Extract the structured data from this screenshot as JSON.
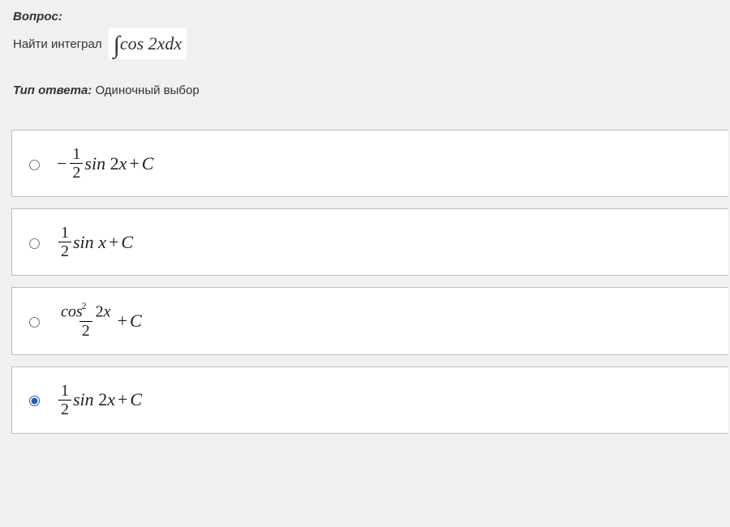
{
  "question": {
    "label": "Вопрос:",
    "prompt_text": "Найти интеграл",
    "integral": {
      "sym": "∫",
      "body": "cos 2xdx"
    }
  },
  "answer_type": {
    "label": "Тип ответа:",
    "value": "Одиночный выбор"
  },
  "options": [
    {
      "id": "opt1",
      "selected": false,
      "lead_minus": "−",
      "frac_num": "1",
      "frac_den": "2",
      "tail_fn": "sin",
      "tail_arg": "2x",
      "plus": "+",
      "const": "C",
      "has_cos_sq": false,
      "show_tail": true
    },
    {
      "id": "opt2",
      "selected": false,
      "lead_minus": "",
      "frac_num": "1",
      "frac_den": "2",
      "tail_fn": "sin",
      "tail_arg": "x",
      "plus": "+",
      "const": "C",
      "has_cos_sq": false,
      "show_tail": true
    },
    {
      "id": "opt3",
      "selected": false,
      "lead_minus": "",
      "frac_num": "",
      "frac_den": "2",
      "cos_sq_fn": "cos",
      "cos_sq_exp": "2",
      "cos_sq_arg": "2x",
      "tail_fn": "",
      "tail_arg": "",
      "plus": "+",
      "const": "C",
      "has_cos_sq": true,
      "show_tail": false
    },
    {
      "id": "opt4",
      "selected": true,
      "lead_minus": "",
      "frac_num": "1",
      "frac_den": "2",
      "tail_fn": "sin",
      "tail_arg": "2x",
      "plus": "+",
      "const": "C",
      "has_cos_sq": false,
      "show_tail": true
    }
  ]
}
